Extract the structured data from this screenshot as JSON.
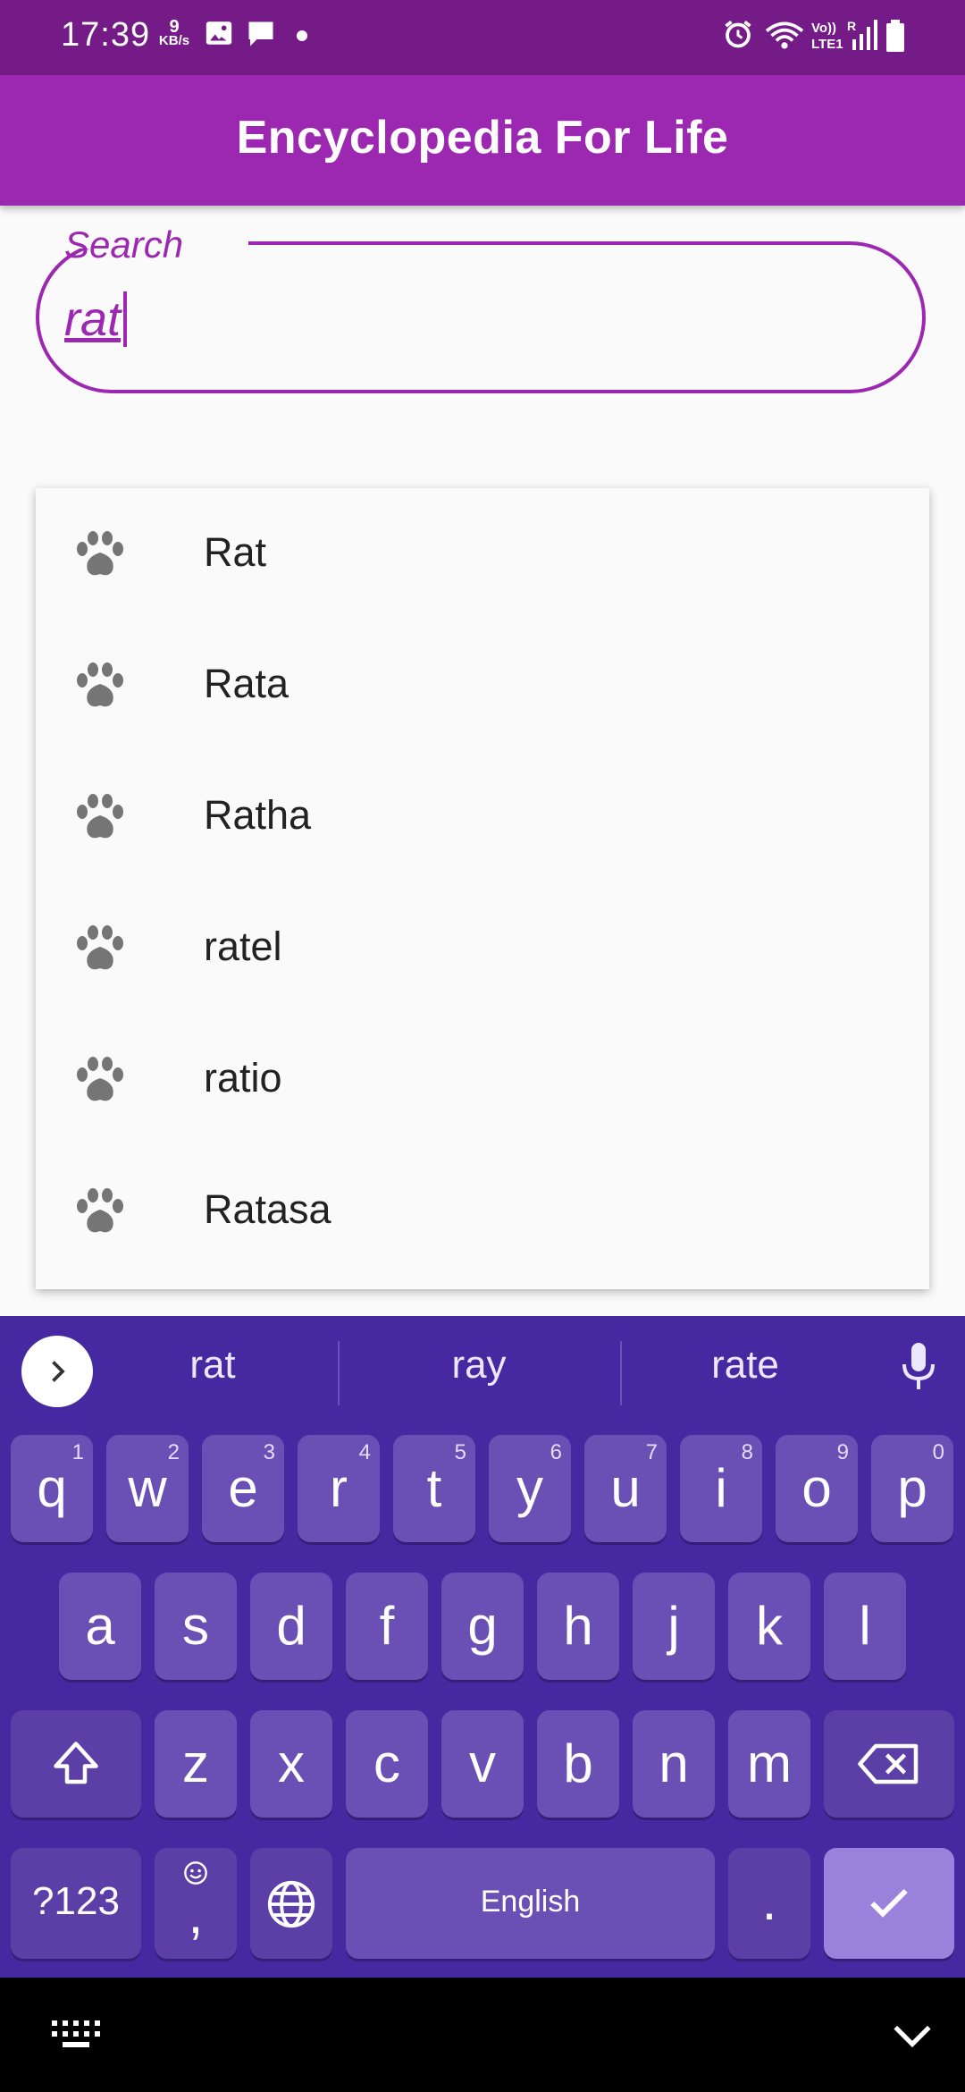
{
  "status_bar": {
    "time": "17:39",
    "speed_value": "9",
    "speed_unit": "KB/s",
    "icons": [
      "gallery-icon",
      "message-icon",
      "alarm-icon",
      "wifi-icon",
      "volte-icon",
      "signal-icon",
      "battery-icon"
    ]
  },
  "app_bar": {
    "title": "Encyclopedia For Life"
  },
  "search": {
    "label": "Search",
    "value": "rat"
  },
  "suggestions": [
    {
      "label": "Rat",
      "icon": "paw-icon"
    },
    {
      "label": "Rata",
      "icon": "paw-icon"
    },
    {
      "label": "Ratha",
      "icon": "paw-icon"
    },
    {
      "label": "ratel",
      "icon": "paw-icon"
    },
    {
      "label": "ratio",
      "icon": "paw-icon"
    },
    {
      "label": "Ratasa",
      "icon": "paw-icon"
    }
  ],
  "keyboard": {
    "suggestions": [
      "rat",
      "ray",
      "rate"
    ],
    "row1": [
      {
        "key": "q",
        "hint": "1"
      },
      {
        "key": "w",
        "hint": "2"
      },
      {
        "key": "e",
        "hint": "3"
      },
      {
        "key": "r",
        "hint": "4"
      },
      {
        "key": "t",
        "hint": "5"
      },
      {
        "key": "y",
        "hint": "6"
      },
      {
        "key": "u",
        "hint": "7"
      },
      {
        "key": "i",
        "hint": "8"
      },
      {
        "key": "o",
        "hint": "9"
      },
      {
        "key": "p",
        "hint": "0"
      }
    ],
    "row2": [
      "a",
      "s",
      "d",
      "f",
      "g",
      "h",
      "j",
      "k",
      "l"
    ],
    "row3": [
      "z",
      "x",
      "c",
      "v",
      "b",
      "n",
      "m"
    ],
    "symbols_label": "?123",
    "comma_label": ",",
    "space_label": "English",
    "period_label": "."
  },
  "colors": {
    "status_bar": "#751b87",
    "app_bar": "#9c27b0",
    "accent": "#9c27b0",
    "keyboard_bg": "#4629a0",
    "key_bg": "#6a4fb4",
    "enter_key_bg": "#9a82dc"
  }
}
